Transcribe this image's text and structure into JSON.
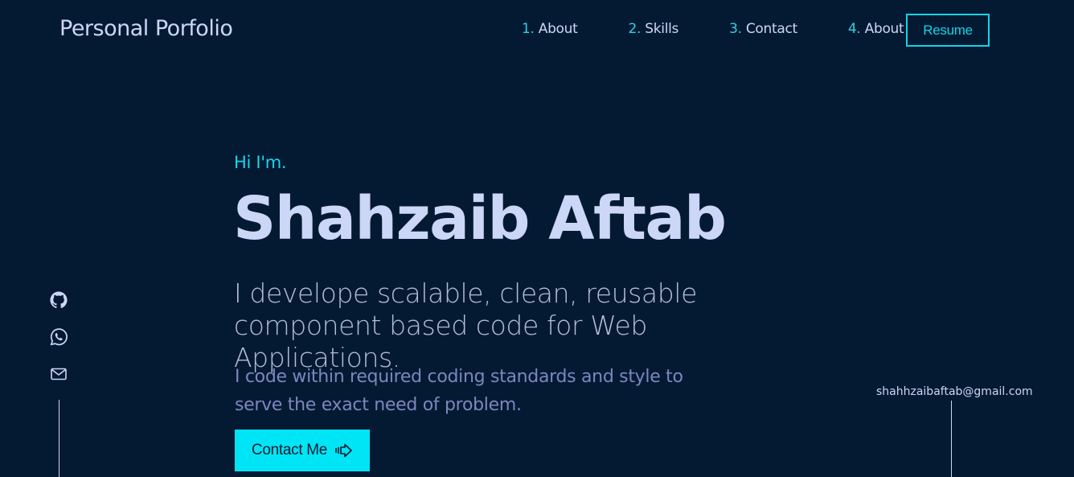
{
  "header": {
    "logo": "Personal Porfolio",
    "nav": [
      {
        "num": "1.",
        "label": "About"
      },
      {
        "num": "2.",
        "label": "Skills"
      },
      {
        "num": "3.",
        "label": "Contact"
      },
      {
        "num": "4.",
        "label": "About"
      }
    ],
    "resume_label": "Resume"
  },
  "hero": {
    "greeting": "Hi I'm.",
    "name": "Shahzaib Aftab",
    "tagline": "I develope scalable, clean, reusable component based code for Web Applications.",
    "description": "I code within required coding standards and style to serve the exact need of problem.",
    "cta_label": "Contact Me"
  },
  "socials": [
    {
      "icon": "github-icon"
    },
    {
      "icon": "whatsapp-icon"
    },
    {
      "icon": "mail-icon"
    }
  ],
  "side_email": "shahhzaibaftab@gmail.com",
  "colors": {
    "background": "#041a32",
    "accent": "#00e5f5",
    "text": "#ccd6f6",
    "muted": "#7d86c0"
  }
}
